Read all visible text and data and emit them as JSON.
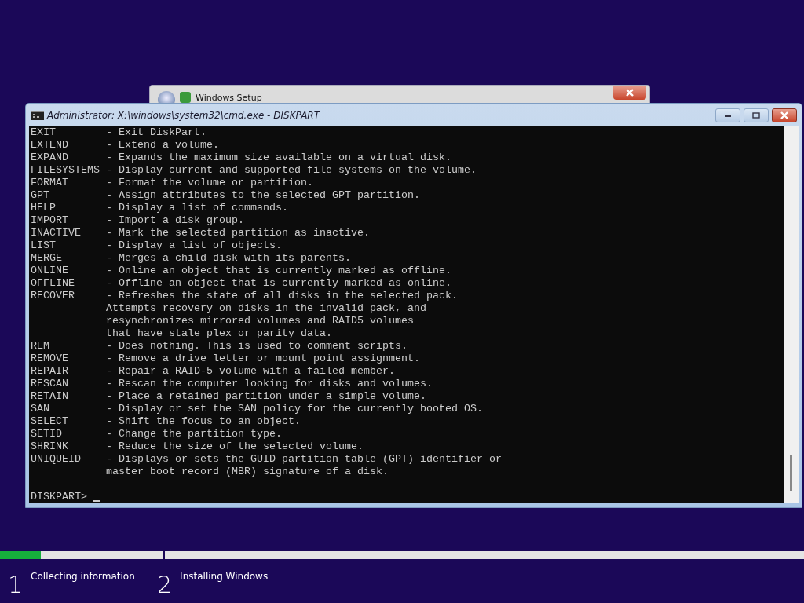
{
  "setup_window": {
    "title": "Windows Setup"
  },
  "console_window": {
    "title": "Administrator: X:\\windows\\system32\\cmd.exe - DISKPART",
    "lines": [
      {
        "command": "EXIT",
        "description": "- Exit DiskPart."
      },
      {
        "command": "EXTEND",
        "description": "- Extend a volume."
      },
      {
        "command": "EXPAND",
        "description": "- Expands the maximum size available on a virtual disk."
      },
      {
        "command": "FILESYSTEMS",
        "description": "- Display current and supported file systems on the volume."
      },
      {
        "command": "FORMAT",
        "description": "- Format the volume or partition."
      },
      {
        "command": "GPT",
        "description": "- Assign attributes to the selected GPT partition."
      },
      {
        "command": "HELP",
        "description": "- Display a list of commands."
      },
      {
        "command": "IMPORT",
        "description": "- Import a disk group."
      },
      {
        "command": "INACTIVE",
        "description": "- Mark the selected partition as inactive."
      },
      {
        "command": "LIST",
        "description": "- Display a list of objects."
      },
      {
        "command": "MERGE",
        "description": "- Merges a child disk with its parents."
      },
      {
        "command": "ONLINE",
        "description": "- Online an object that is currently marked as offline."
      },
      {
        "command": "OFFLINE",
        "description": "- Offline an object that is currently marked as online."
      },
      {
        "command": "RECOVER",
        "description": "- Refreshes the state of all disks in the selected pack."
      },
      {
        "description": "Attempts recovery on disks in the invalid pack, and"
      },
      {
        "description": "resynchronizes mirrored volumes and RAID5 volumes"
      },
      {
        "description": "that have stale plex or parity data."
      },
      {
        "command": "REM",
        "description": "- Does nothing. This is used to comment scripts."
      },
      {
        "command": "REMOVE",
        "description": "- Remove a drive letter or mount point assignment."
      },
      {
        "command": "REPAIR",
        "description": "- Repair a RAID-5 volume with a failed member."
      },
      {
        "command": "RESCAN",
        "description": "- Rescan the computer looking for disks and volumes."
      },
      {
        "command": "RETAIN",
        "description": "- Place a retained partition under a simple volume."
      },
      {
        "command": "SAN",
        "description": "- Display or set the SAN policy for the currently booted OS."
      },
      {
        "command": "SELECT",
        "description": "- Shift the focus to an object."
      },
      {
        "command": "SETID",
        "description": "- Change the partition type."
      },
      {
        "command": "SHRINK",
        "description": "- Reduce the size of the selected volume."
      },
      {
        "command": "UNIQUEID",
        "description": "- Displays or sets the GUID partition table (GPT) identifier or"
      },
      {
        "description": "master boot record (MBR) signature of a disk."
      }
    ],
    "prompt": "DISKPART>"
  },
  "steps": [
    {
      "number": "1",
      "label": "Collecting information",
      "level": 0.25
    },
    {
      "number": "2",
      "label": "Installing Windows",
      "level": 0
    }
  ]
}
